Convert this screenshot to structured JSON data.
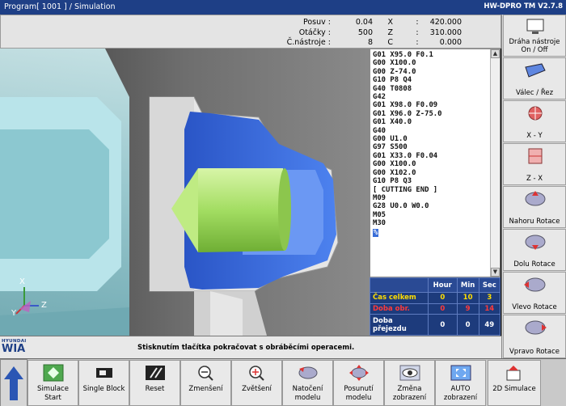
{
  "title_bar": {
    "program": "Program[ 1001 ] / Simulation",
    "version": "HW-DPRO TM V2.7.8"
  },
  "status": {
    "labels": [
      "Posuv",
      "Otáčky",
      "Č.nástroje"
    ],
    "values": [
      "0.04",
      "500",
      "8"
    ],
    "axes": [
      "X",
      "Z",
      "C"
    ],
    "axis_values": [
      "420.000",
      "310.000",
      "0.000"
    ]
  },
  "gcode": {
    "lines": [
      "G01 X95.0 F0.1",
      "G00 X100.0",
      "G00 Z-74.0",
      "G10 P8 Q4",
      "G40 T0808",
      "G42",
      "G01 X98.0 F0.09",
      "G01 X96.0 Z-75.0",
      "G01 X40.0",
      "G40",
      "G00 U1.0",
      "G97 S500",
      "G01 X33.0 F0.04",
      "G00 X100.0",
      "G00 X102.0",
      "G10 P8 Q3",
      "[ CUTTING END ]",
      "M09",
      "G28 U0.0 W0.0",
      "M05",
      "M30"
    ],
    "cursor": "%"
  },
  "time_table": {
    "headers": [
      "",
      "Hour",
      "Min",
      "Sec"
    ],
    "rows": [
      {
        "label": "Čas celkem",
        "hour": "0",
        "min": "10",
        "sec": "3"
      },
      {
        "label": "Doba obr.",
        "hour": "0",
        "min": "9",
        "sec": "14"
      },
      {
        "label": "Doba přejezdu",
        "hour": "0",
        "min": "0",
        "sec": "49"
      }
    ]
  },
  "side_buttons": [
    {
      "label": "Dráha nástroje On / Off",
      "icon": "monitor-icon"
    },
    {
      "label": "Válec / Řez",
      "icon": "cylinder-cut-icon"
    },
    {
      "label": "X - Y",
      "icon": "xy-view-icon"
    },
    {
      "label": "Z - X",
      "icon": "zx-view-icon"
    },
    {
      "label": "Nahoru Rotace",
      "icon": "rotate-up-icon"
    },
    {
      "label": "Dolu Rotace",
      "icon": "rotate-down-icon"
    },
    {
      "label": "Vlevo Rotace",
      "icon": "rotate-left-icon"
    },
    {
      "label": "Vpravo Rotace",
      "icon": "rotate-right-icon"
    }
  ],
  "message": {
    "logo_top": "HYUNDAI",
    "logo_main": "WIA",
    "text": "Stisknutím tlačítka pokračovat s obráběcími operacemi."
  },
  "softkeys": [
    {
      "label": "Simulace Start",
      "icon": "play-diamond-icon"
    },
    {
      "label": "Single Block",
      "icon": "single-block-icon"
    },
    {
      "label": "Reset",
      "icon": "reset-icon"
    },
    {
      "label": "Zmenšení",
      "icon": "zoom-out-icon"
    },
    {
      "label": "Zvětšení",
      "icon": "zoom-in-icon"
    },
    {
      "label": "Natočení modelu",
      "icon": "rotate-model-icon"
    },
    {
      "label": "Posunutí modelu",
      "icon": "move-model-icon"
    },
    {
      "label": "Změna zobrazení",
      "icon": "eye-icon"
    },
    {
      "label": "AUTO zobrazení",
      "icon": "auto-view-icon"
    },
    {
      "label": "2D Simulace",
      "icon": "2d-sim-icon"
    }
  ],
  "axis_triad": {
    "x": "X",
    "y": "Y",
    "z": "Z"
  },
  "colors": {
    "title_bar": "#1e3f86",
    "part": "#2f62d8",
    "cone": "#a8e26a",
    "chuck": "#a8dde4",
    "highlight_row": "#ffde00",
    "alert_row": "#ff3a3a"
  }
}
